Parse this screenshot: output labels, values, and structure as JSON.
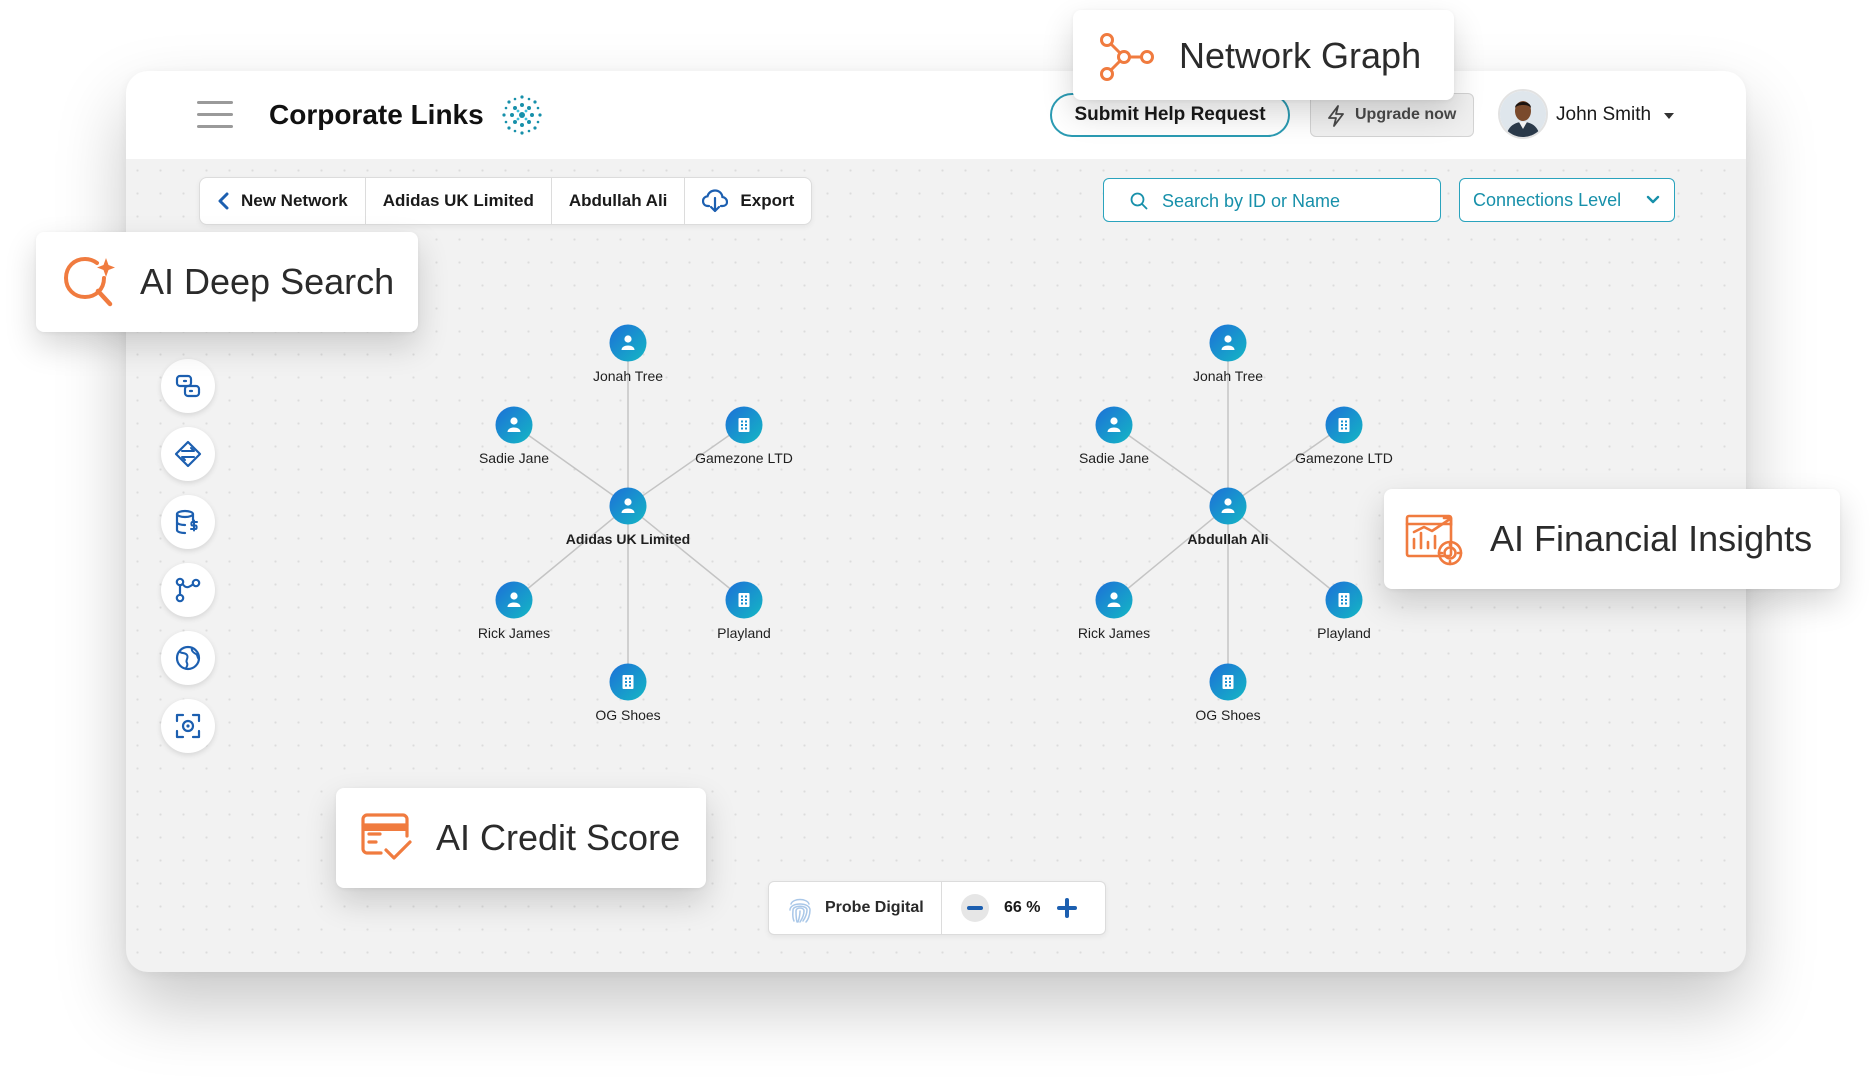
{
  "header": {
    "title": "Corporate Links",
    "help_button": "Submit Help Request",
    "upgrade_button": "Upgrade now",
    "user_name": "John Smith"
  },
  "tabs": [
    {
      "label": "New Network",
      "icon": "chevron-left-icon"
    },
    {
      "label": "Adidas UK Limited"
    },
    {
      "label": "Abdullah Ali"
    },
    {
      "label": "Export",
      "icon": "cloud-download-icon"
    }
  ],
  "search": {
    "placeholder": "Search by ID or Name"
  },
  "connections_dropdown": {
    "label": "Connections Level"
  },
  "toolbar_icons": [
    "link-icon",
    "exchange-icon",
    "database-dollar-icon",
    "branch-icon",
    "globe-icon",
    "scan-focus-icon"
  ],
  "networks": [
    {
      "center": "Adidas UK Limited",
      "nodes": [
        {
          "label": "Jonah Tree",
          "type": "person"
        },
        {
          "label": "Sadie Jane",
          "type": "person"
        },
        {
          "label": "Gamezone LTD",
          "type": "company"
        },
        {
          "label": "Rick James",
          "type": "person"
        },
        {
          "label": "Playland",
          "type": "company"
        },
        {
          "label": "OG Shoes",
          "type": "company"
        }
      ]
    },
    {
      "center": "Abdullah Ali",
      "nodes": [
        {
          "label": "Jonah Tree",
          "type": "person"
        },
        {
          "label": "Sadie Jane",
          "type": "person"
        },
        {
          "label": "Gamezone LTD",
          "type": "company"
        },
        {
          "label": "Rick James",
          "type": "person"
        },
        {
          "label": "Playland",
          "type": "company"
        },
        {
          "label": "OG Shoes",
          "type": "company"
        }
      ]
    }
  ],
  "zoom": {
    "brand": "Probe Digital",
    "level": "66 %"
  },
  "features": {
    "network_graph": "Network Graph",
    "deep_search": "AI Deep Search",
    "financial": "AI Financial Insights",
    "credit": "AI Credit Score"
  },
  "colors": {
    "accent": "#f07b3f",
    "teal": "#1790aa",
    "node_from": "#1d6fd8",
    "node_to": "#14b8c4"
  }
}
